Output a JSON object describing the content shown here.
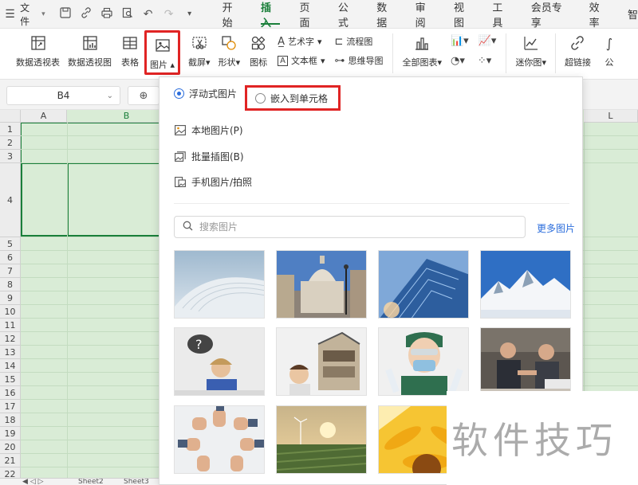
{
  "menubar": {
    "file_label": "文件",
    "tabs": [
      "开始",
      "插入",
      "页面",
      "公式",
      "数据",
      "审阅",
      "视图",
      "工具",
      "会员专享",
      "效率",
      "智"
    ]
  },
  "ribbon": {
    "pivot_table": "数据透视表",
    "pivot_chart": "数据透视图",
    "table": "表格",
    "picture": "图片",
    "screenshot": "截屏",
    "shapes": "形状",
    "icons": "图标",
    "wordart": "艺术字",
    "textbox": "文本框",
    "flowchart": "流程图",
    "mindmap": "思维导图",
    "all_charts": "全部图表",
    "sparkline": "迷你图",
    "hyperlink": "超链接",
    "formula_cut": "公"
  },
  "formula_bar": {
    "cell_ref": "B4"
  },
  "grid": {
    "columns": [
      "A",
      "B",
      "L"
    ],
    "rows": [
      "1",
      "2",
      "3",
      "4",
      "5",
      "6",
      "7",
      "8",
      "9",
      "10",
      "11",
      "12",
      "13",
      "14",
      "15",
      "16",
      "17",
      "18",
      "19",
      "20",
      "21",
      "22"
    ]
  },
  "sheets": [
    "Sheet2",
    "Sheet3"
  ],
  "panel": {
    "float_picture": "浮动式图片",
    "embed_cell": "嵌入到单元格",
    "local_picture": "本地图片(P)",
    "batch_insert": "批量插图(B)",
    "phone_picture": "手机图片/拍照",
    "search_placeholder": "搜索图片",
    "more_pictures": "更多图片"
  },
  "watermark": "软件技巧",
  "colors": {
    "accent": "#1a7f3a",
    "highlight": "#e02424",
    "link": "#2b6ddc",
    "grid_fill": "#d9ecd6"
  }
}
